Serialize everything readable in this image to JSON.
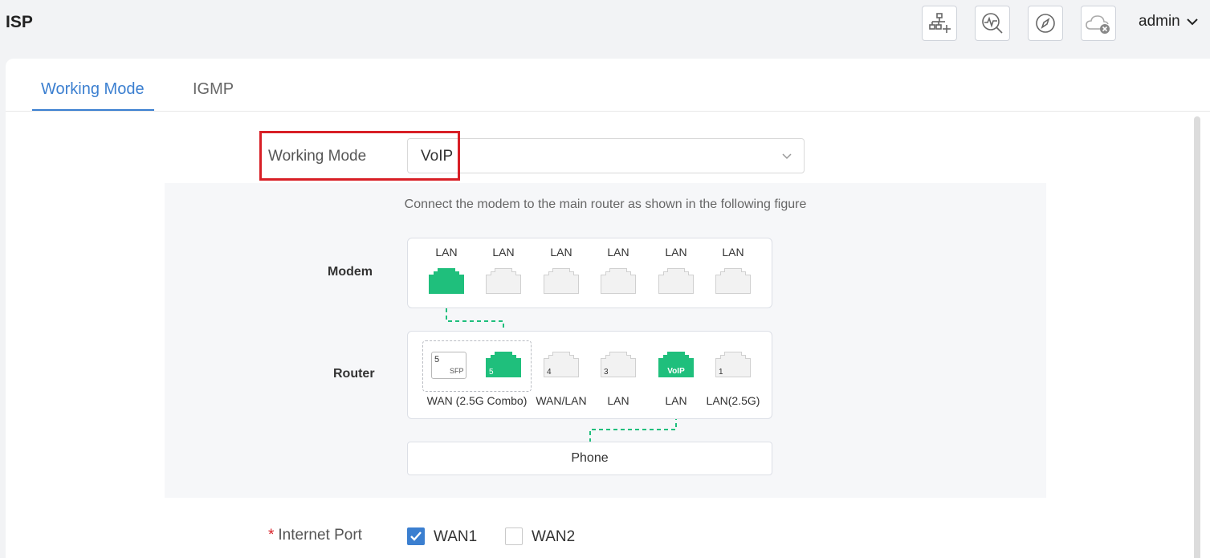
{
  "page": {
    "title": "ISP"
  },
  "header": {
    "icons": [
      "topology-icon",
      "diagnostics-icon",
      "compass-icon",
      "cloud-offline-icon"
    ],
    "user": "admin"
  },
  "tabs": [
    {
      "label": "Working Mode",
      "active": true
    },
    {
      "label": "IGMP",
      "active": false
    }
  ],
  "form": {
    "working_mode_label": "Working Mode",
    "working_mode_value": "VoIP",
    "internet_port_required": "*",
    "internet_port_label": "Internet Port",
    "wan1": {
      "label": "WAN1",
      "checked": true
    },
    "wan2": {
      "label": "WAN2",
      "checked": false
    }
  },
  "diagram": {
    "hint": "Connect the modem to the main router as shown in the following figure",
    "modem_label": "Modem",
    "router_label": "Router",
    "modem_ports": [
      "LAN",
      "LAN",
      "LAN",
      "LAN",
      "LAN",
      "LAN"
    ],
    "router_port_numbers": [
      "5",
      "5",
      "4",
      "3",
      "VoIP",
      "1"
    ],
    "sfp_text": "SFP",
    "router_port_labels": [
      "WAN (2.5G Combo)",
      "WAN/LAN",
      "LAN",
      "LAN",
      "LAN(2.5G)"
    ],
    "phone_label": "Phone"
  },
  "colors": {
    "accent": "#3b7fd0",
    "active_port": "#1fbf7c",
    "highlight": "#d81f26"
  }
}
